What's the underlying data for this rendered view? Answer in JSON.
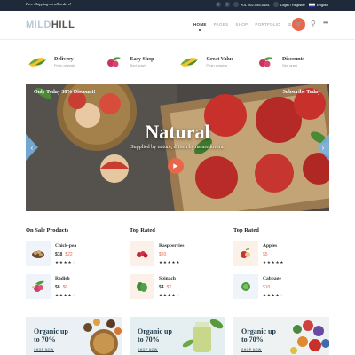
{
  "topbar": {
    "promo": "Free Shipping on all orders!",
    "phone": "+01 202-555-0181",
    "login": "Login / Register",
    "language": "English",
    "social_icons": [
      "facebook-icon",
      "twitter-icon"
    ]
  },
  "header": {
    "logo_part1": "MILD",
    "logo_part2": "HILL",
    "nav": [
      "HOME",
      "PAGES",
      "SHOP",
      "PORTFOLIO",
      "BLOG"
    ],
    "active_nav": "HOME"
  },
  "features": [
    {
      "title": "Delivery",
      "subtitle": "Proin gravida",
      "icon": "corn-icon"
    },
    {
      "title": "Easy Shop",
      "subtitle": "Sed gravi",
      "icon": "radish-icon"
    },
    {
      "title": "Great Value",
      "subtitle": "Proin gravida",
      "icon": "corn-icon"
    },
    {
      "title": "Discounts",
      "subtitle": "Sed gravi",
      "icon": "radish-icon"
    }
  ],
  "hero": {
    "ribbon_left": "Only Today 30% Discount!",
    "ribbon_right": "Subscribe Today",
    "headline": "Natural",
    "tagline": "Supplied by nature, driven by nature lovers."
  },
  "products": {
    "columns": [
      {
        "title": "On Sale Products",
        "items": [
          {
            "name": "Chick-pea",
            "price": "$18",
            "old_price": "$22",
            "stars": 4,
            "icon": "chickpea-icon",
            "bg": "#eef4f9"
          },
          {
            "name": "Radish",
            "price": "$8",
            "old_price": "$6",
            "stars": 4,
            "icon": "radish-icon",
            "bg": "#eef4f9"
          }
        ]
      },
      {
        "title": "Top Rated",
        "items": [
          {
            "name": "Raspberries",
            "price": "",
            "old_price": "$20",
            "stars": 5,
            "icon": "raspberry-icon",
            "bg": "#fbf1e9"
          },
          {
            "name": "Spinach",
            "price": "$4",
            "old_price": "$2",
            "stars": 4,
            "icon": "spinach-icon",
            "bg": "#fbf1e9"
          }
        ]
      },
      {
        "title": "Top Rated",
        "items": [
          {
            "name": "Apples",
            "price": "",
            "old_price": "$5",
            "stars": 5,
            "icon": "apple-icon",
            "bg": "#fbf1e9"
          },
          {
            "name": "Cabbage",
            "price": "",
            "old_price": "$10",
            "stars": 4,
            "icon": "cabbage-icon",
            "bg": "#eef4f9"
          }
        ]
      }
    ]
  },
  "banners": [
    {
      "line1": "Organic up",
      "line2": "to 70%",
      "button": "SHOP NOW",
      "bg": "#eaf0f4"
    },
    {
      "line1": "Organic up",
      "line2": "to 70%",
      "button": "SHOP NOW",
      "bg": "#e5eff2"
    },
    {
      "line1": "Organic up",
      "line2": "to 70%",
      "button": "SHOP NOW",
      "bg": "#eef2f3"
    }
  ],
  "colors": {
    "accent": "#e9664b",
    "topbar": "#1e2a3a",
    "slider_arrow": "#78b4e6"
  }
}
